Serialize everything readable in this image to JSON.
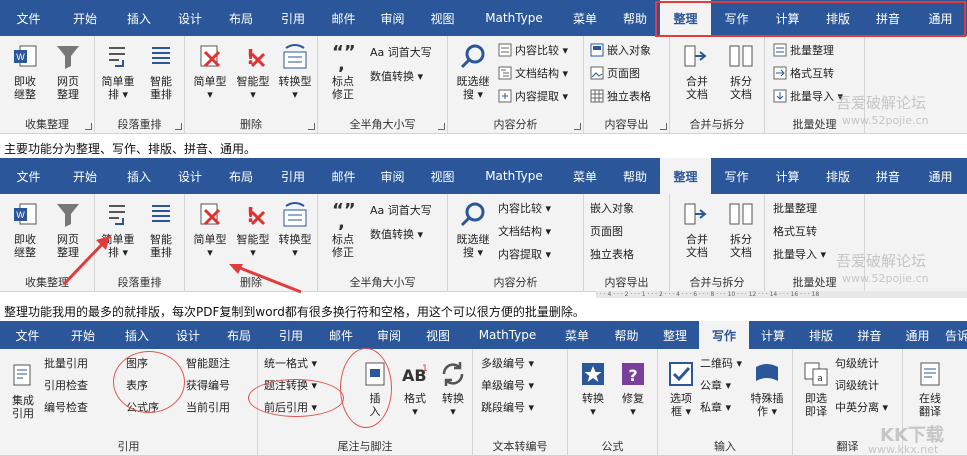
{
  "shot1": {
    "tabs": [
      "文件",
      "开始",
      "插入",
      "设计",
      "布局",
      "引用",
      "邮件",
      "审阅",
      "视图",
      "MathType",
      "菜单",
      "帮助",
      "整理",
      "写作",
      "计算",
      "排版",
      "拼音",
      "通用"
    ],
    "active_tab": "整理",
    "groups": [
      {
        "name": "收集整理",
        "buttons": [
          "即收\n继整",
          "网页\n整理"
        ]
      },
      {
        "name": "段落重排",
        "buttons": [
          "简单重\n排 ▾",
          "智能\n重排"
        ]
      },
      {
        "name": "删除",
        "buttons": [
          "简单型\n▾",
          "智能型\n▾",
          "转换型\n▾"
        ]
      },
      {
        "name": "全半角大小写",
        "buttons": [
          "标点\n修正"
        ],
        "small": [
          "Aa 词首大写",
          "数值转换 ▾"
        ]
      },
      {
        "name": "内容分析",
        "buttons": [
          "既选继\n搜 ▾"
        ],
        "small": [
          "内容比较 ▾",
          "文档结构 ▾",
          "内容提取 ▾"
        ]
      },
      {
        "name": "内容导出",
        "small": [
          "嵌入对象",
          "页面图",
          "独立表格"
        ]
      },
      {
        "name": "合并与拆分",
        "buttons": [
          "合并\n文档",
          "拆分\n文档"
        ]
      },
      {
        "name": "批量处理",
        "small": [
          "批量整理",
          "格式互转",
          "批量导入 ▾"
        ]
      }
    ],
    "watermark1": "吾爱破解论坛",
    "watermark2": "www.52pojie.cn"
  },
  "caption1": "主要功能分为整理、写作、排版、拼音、通用。",
  "shot2": {
    "watermark1": "吾爱破解论坛",
    "watermark2": "www.52pojie.cn",
    "ruler": "· · · 4 · · · 2 · · · 1 · · · 2 · · · 4 · · · 6 · · · 8 · · · 10 · · · 12 · · · 14 · · · 16 · · · 18"
  },
  "caption2": "整理功能我用的最多的就排版，每次PDF复制到word都有很多换行符和空格，用这个可以很方便的批量删除。",
  "shot3": {
    "tabs": [
      "文件",
      "开始",
      "插入",
      "设计",
      "布局",
      "引用",
      "邮件",
      "审阅",
      "视图",
      "MathType",
      "菜单",
      "帮助",
      "整理",
      "写作",
      "计算",
      "排版",
      "拼音",
      "通用",
      "告诉我你"
    ],
    "active_tab": "写作",
    "groups": [
      {
        "name": "引用",
        "buttons": [
          "集成\n引用"
        ],
        "small": [
          "批量引用",
          "引用检查",
          "编号检查",
          "图序",
          "表序",
          "公式序",
          "智能题注",
          "获得编号",
          "当前引用"
        ]
      },
      {
        "name": "尾注与脚注",
        "buttons": [
          "插\n入",
          "格式\n▾",
          "转换\n▾"
        ],
        "small": [
          "统一格式 ▾",
          "题注转换 ▾",
          "前后引用 ▾"
        ]
      },
      {
        "name": "文本转编号",
        "small": [
          "多级编号 ▾",
          "单级编号 ▾",
          "跳段编号 ▾"
        ]
      },
      {
        "name": "公式",
        "buttons": [
          "转换\n▾",
          "修复\n▾"
        ]
      },
      {
        "name": "输入",
        "buttons": [
          "选项\n框 ▾",
          "特殊插\n作 ▾"
        ],
        "small": [
          "二维码 ▾",
          "公章 ▾",
          "私章 ▾"
        ]
      },
      {
        "name": "翻译",
        "buttons": [
          "即选\n即译"
        ],
        "small": [
          "句级统计",
          "词级统计",
          "中英分离 ▾"
        ]
      },
      {
        "name": "",
        "buttons": [
          "在线\n翻译"
        ]
      }
    ],
    "watermark": "www.kkx.net",
    "watermark_logo": "KK下载"
  },
  "colors": {
    "tab_bg": "#2b579a",
    "ribbon_bg": "#f3f3f3",
    "accent_red": "#e03c3c"
  }
}
